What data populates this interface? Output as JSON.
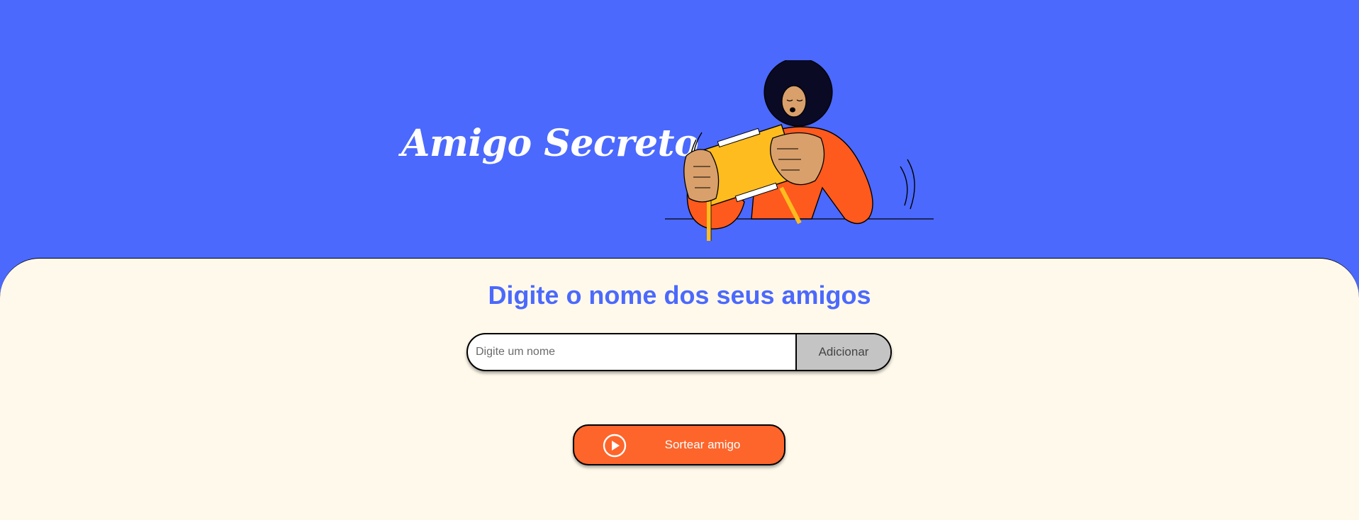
{
  "header": {
    "title": "Amigo Secreto",
    "illustration_icon": "person-opening-gift-box-illustration"
  },
  "main": {
    "section_title": "Digite o nome dos seus amigos",
    "name_input": {
      "placeholder": "Digite um nome",
      "value": ""
    },
    "add_button_label": "Adicionar",
    "draw_button_label": "Sortear amigo",
    "draw_button_icon": "play-circle-icon"
  },
  "colors": {
    "header_bg": "#4B69FD",
    "main_bg": "#FFF9EB",
    "title_accent": "#4B69FD",
    "draw_button_bg": "#FE652B",
    "add_button_bg": "#C4C4C4"
  }
}
